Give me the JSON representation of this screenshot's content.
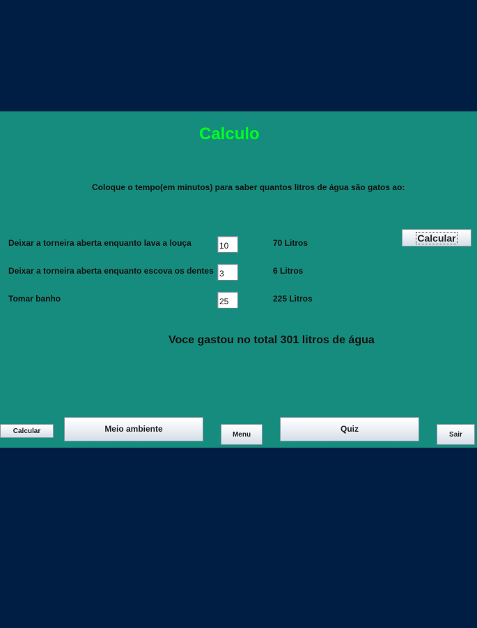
{
  "calculo": {
    "title": "Calculo",
    "instruction": "Coloque o tempo(em minutos) para saber quantos litros de água são gatos ao:",
    "calculate_button": "Calcular",
    "rows": [
      {
        "label": "Deixar a torneira aberta enquanto lava a louça",
        "minutes": "10",
        "result": "70 Litros"
      },
      {
        "label": "Deixar a torneira aberta enquanto escova os dentes",
        "minutes": "3",
        "result": "6 Litros"
      },
      {
        "label": "Tomar banho",
        "minutes": "25",
        "result": "225 Litros"
      }
    ],
    "total": "Voce gastou no total 301 litros de água"
  },
  "nav": {
    "calcular": "Calcular",
    "meio_ambiente": "Meio ambiente",
    "menu": "Menu",
    "quiz": "Quiz",
    "sair": "Sair"
  },
  "colors": {
    "background": "#001e43",
    "panel": "#168c7e",
    "title": "#00ff22"
  }
}
